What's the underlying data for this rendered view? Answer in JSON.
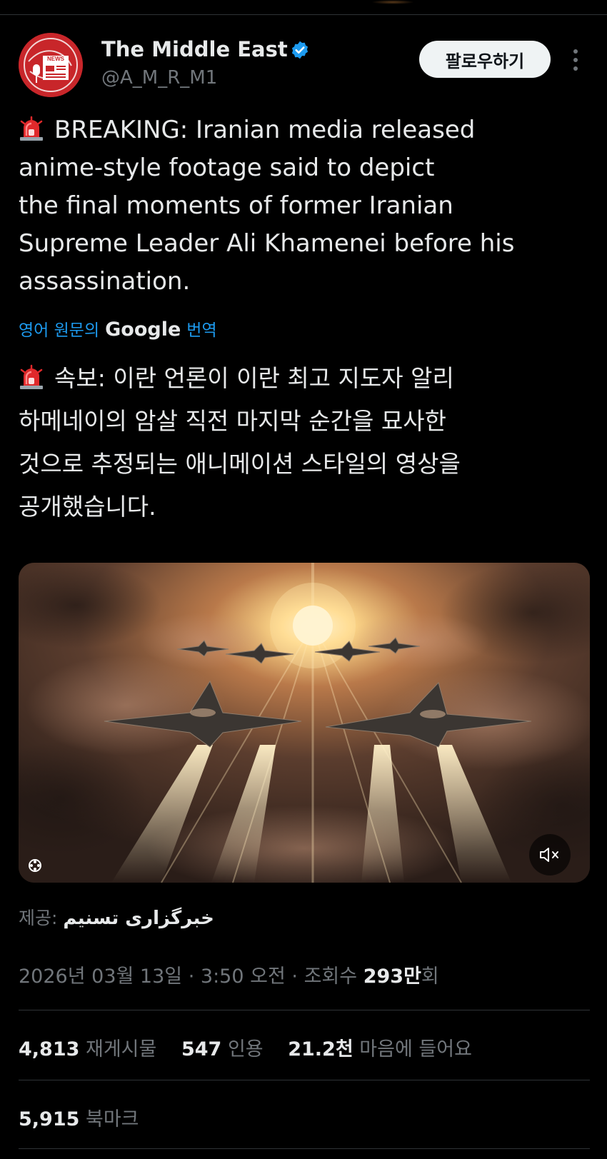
{
  "author": {
    "display_name": "The Middle East",
    "handle": "@A_M_R_M1",
    "avatar_text": "NEWS",
    "follow_label": "팔로우하기"
  },
  "tweet": {
    "lines": [
      "BREAKING: Iranian media released",
      "anime-style footage said to depict",
      "the final moments of former Iranian",
      "Supreme Leader Ali Khamenei before his",
      "assassination."
    ],
    "emoji_icon": "rotating-light-icon"
  },
  "translation": {
    "prefix": "영어 원문의",
    "brand": "Google",
    "suffix": "번역",
    "lines": [
      "속보: 이란 언론이 이란 최고 지도자 알리",
      "하메네이의 암살 직전 마지막 순간을 묘사한",
      "것으로 추정되는 애니메이션 스타일의 영상을",
      "공개했습니다."
    ]
  },
  "media": {
    "mute_icon": "speaker-muted-icon",
    "gif_icon": "gif-badge-icon"
  },
  "source": {
    "label": "제공:",
    "name": "خبرگزاری تسنیم"
  },
  "meta": {
    "date": "2026년 03월 13일",
    "sep1": "·",
    "time": "3:50 오전",
    "sep2": "·",
    "views_label": "조회수",
    "views_count": "293만",
    "views_suffix": "회"
  },
  "stats": {
    "retweets": "4,813",
    "retweets_label": "재게시물",
    "quotes": "547",
    "quotes_label": "인용",
    "likes": "21.2천",
    "likes_label": "마음에 들어요"
  },
  "bookmarks": {
    "count": "5,915",
    "label": "북마크"
  },
  "colors": {
    "background": "#000000",
    "text": "#e7e9ea",
    "muted": "#71767b",
    "link": "#1d9bf0",
    "verified": "#1d9bf0",
    "avatar_red": "#c8262a"
  }
}
